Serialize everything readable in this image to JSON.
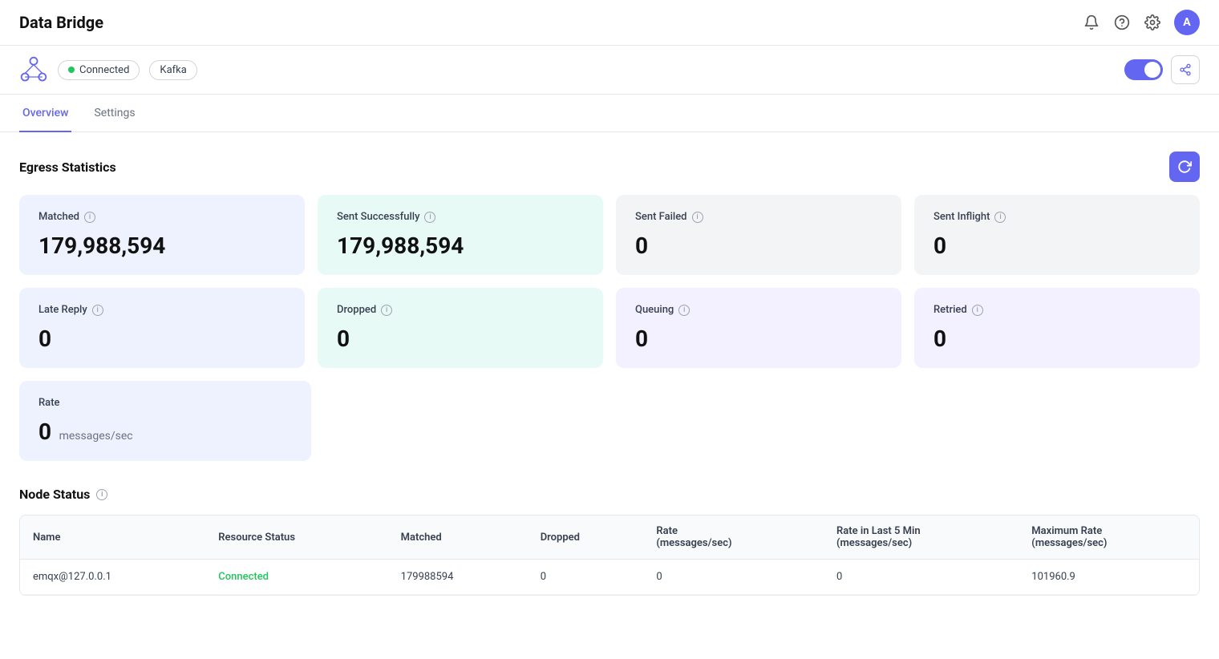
{
  "header": {
    "title": "Data Bridge",
    "icons": {
      "bell": "🔔",
      "help": "?",
      "settings": "⚙",
      "avatar_label": "A"
    }
  },
  "sub_header": {
    "connected_label": "Connected",
    "kafka_label": "Kafka",
    "toggle_on": true
  },
  "tabs": [
    {
      "id": "overview",
      "label": "Overview",
      "active": true
    },
    {
      "id": "settings",
      "label": "Settings",
      "active": false
    }
  ],
  "egress": {
    "section_title": "Egress Statistics",
    "refresh_icon": "↻",
    "stats_row1": [
      {
        "label": "Matched",
        "value": "179,988,594"
      },
      {
        "label": "Sent Successfully",
        "value": "179,988,594"
      },
      {
        "label": "Sent Failed",
        "value": "0"
      },
      {
        "label": "Sent Inflight",
        "value": "0"
      }
    ],
    "stats_row2": [
      {
        "label": "Late Reply",
        "value": "0"
      },
      {
        "label": "Dropped",
        "value": "0"
      },
      {
        "label": "Queuing",
        "value": "0"
      },
      {
        "label": "Retried",
        "value": "0"
      }
    ],
    "stats_row3": [
      {
        "label": "Rate",
        "value": "0",
        "unit": "messages/sec"
      }
    ]
  },
  "node_status": {
    "section_title": "Node Status",
    "table": {
      "columns": [
        "Name",
        "Resource Status",
        "Matched",
        "Dropped",
        "Rate\n(messages/sec)",
        "Rate in Last 5 Min\n(messages/sec)",
        "Maximum Rate\n(messages/sec)"
      ],
      "rows": [
        {
          "name": "emqx@127.0.0.1",
          "resource_status": "Connected",
          "matched": "179988594",
          "dropped": "0",
          "rate": "0",
          "rate_5min": "0",
          "max_rate": "101960.9"
        }
      ]
    }
  }
}
